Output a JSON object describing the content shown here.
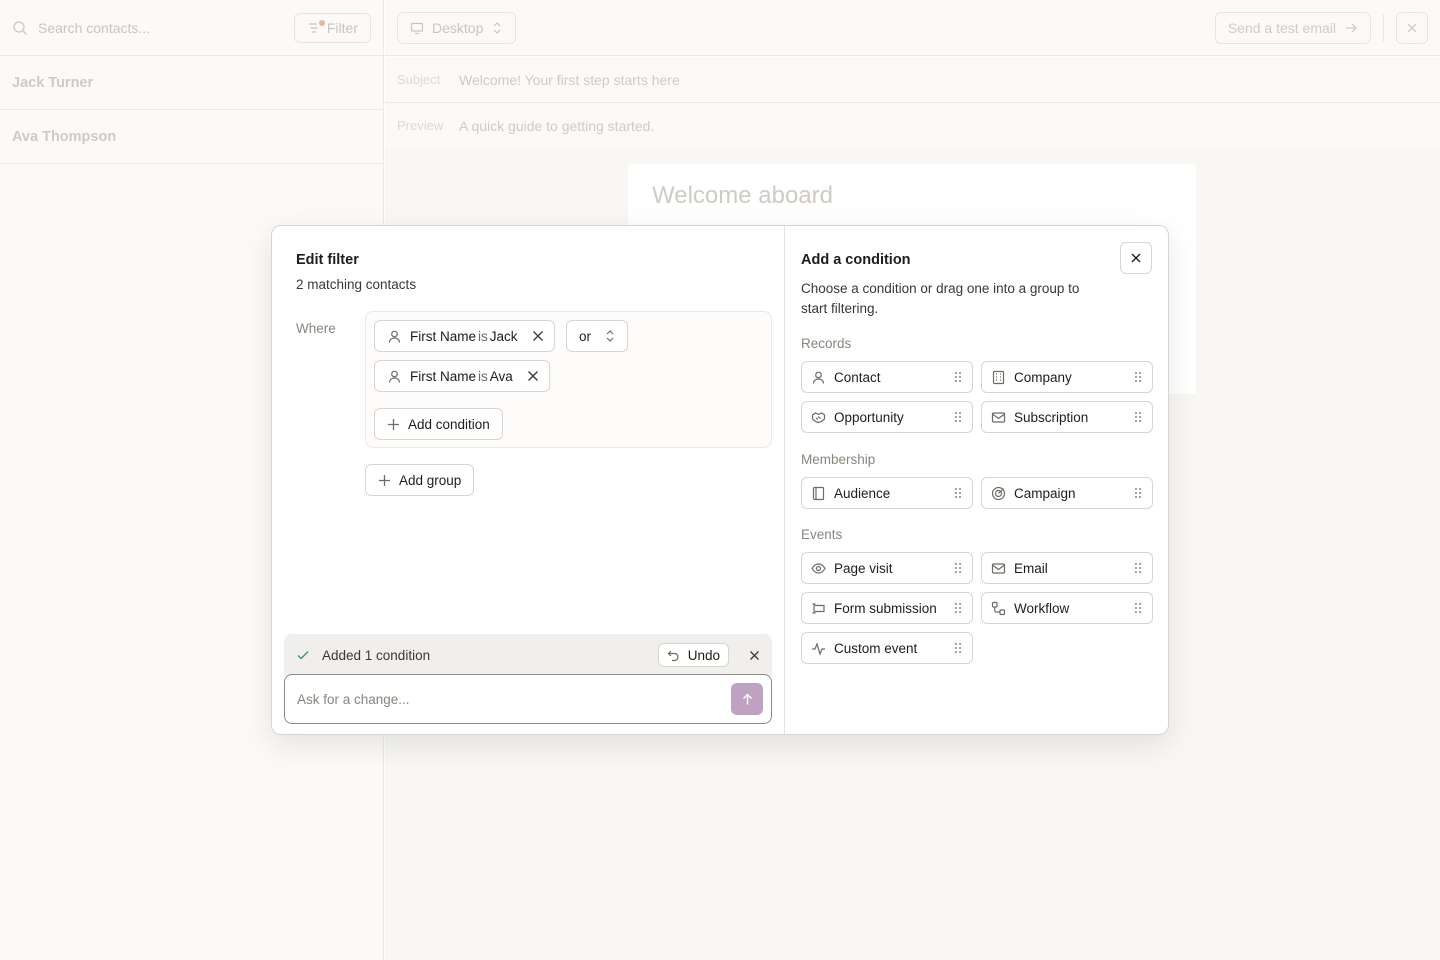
{
  "background": {
    "search_placeholder": "Search contacts...",
    "filter_label": "Filter",
    "contacts": [
      "Jack Turner",
      "Ava Thompson"
    ],
    "device_label": "Desktop",
    "send_test_label": "Send a test email",
    "subject_label": "Subject",
    "subject_value": "Welcome! Your first step starts here",
    "preview_label": "Preview",
    "preview_value": "A quick guide to getting started.",
    "canvas_heading": "Welcome aboard"
  },
  "edit_filter": {
    "title": "Edit filter",
    "subtitle": "2 matching contacts",
    "where_label": "Where",
    "conditions": [
      {
        "field": "First Name",
        "operator": "is",
        "value": "Jack"
      },
      {
        "field": "First Name",
        "operator": "is",
        "value": "Ava"
      }
    ],
    "logic_operator": "or",
    "add_condition_label": "Add condition",
    "add_group_label": "Add group",
    "toast_text": "Added 1 condition",
    "undo_label": "Undo",
    "ask_placeholder": "Ask for a change..."
  },
  "add_condition": {
    "title": "Add a condition",
    "description": "Choose a condition or drag one into a group to start filtering.",
    "sections": [
      {
        "label": "Records",
        "items": [
          {
            "label": "Contact",
            "icon": "person-icon"
          },
          {
            "label": "Company",
            "icon": "building-icon"
          },
          {
            "label": "Opportunity",
            "icon": "handshake-icon"
          },
          {
            "label": "Subscription",
            "icon": "mail-icon"
          }
        ]
      },
      {
        "label": "Membership",
        "items": [
          {
            "label": "Audience",
            "icon": "book-icon"
          },
          {
            "label": "Campaign",
            "icon": "target-icon"
          }
        ]
      },
      {
        "label": "Events",
        "items": [
          {
            "label": "Page visit",
            "icon": "eye-icon"
          },
          {
            "label": "Email",
            "icon": "mail-icon"
          },
          {
            "label": "Form submission",
            "icon": "form-icon"
          },
          {
            "label": "Workflow",
            "icon": "workflow-icon"
          },
          {
            "label": "Custom event",
            "icon": "activity-icon"
          }
        ]
      }
    ]
  },
  "colors": {
    "accent_send": "#bfa2c2",
    "toast_bg": "#f1efeb",
    "check_green": "#4a9a5e"
  }
}
